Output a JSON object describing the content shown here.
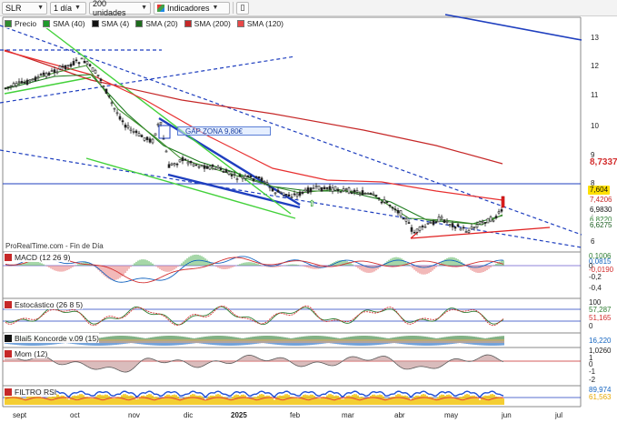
{
  "toolbar": {
    "symbol": "SLR",
    "timeframe": "1 día",
    "units": "200 unidades",
    "indicators_label": "Indicadores"
  },
  "main_legend": {
    "items": [
      {
        "label": "Precio",
        "color": "#2e8b2e"
      },
      {
        "label": "SMA (40)",
        "color": "#1e9a2a"
      },
      {
        "label": "SMA (4)",
        "color": "#111111"
      },
      {
        "label": "SMA (20)",
        "color": "#1d6b1d"
      },
      {
        "label": "SMA (200)",
        "color": "#c62828"
      },
      {
        "label": "SMA (120)",
        "color": "#e84848"
      }
    ]
  },
  "annotations": {
    "gap_label": "GAP ZONA 9,80€",
    "source": "ProRealTime.com - Fin de Día"
  },
  "price_axis": {
    "ticks": [
      "13",
      "12",
      "11",
      "10",
      "9",
      "8",
      "7",
      "6"
    ],
    "tags": [
      {
        "text": "8,7337",
        "color": "#d32f2f",
        "bg": "#ffffff"
      },
      {
        "text": "7,604",
        "color": "#111111",
        "bg": "#ffe000"
      },
      {
        "text": "7,4206",
        "color": "#c62828",
        "bg": "#ffffff"
      },
      {
        "text": "6,9830",
        "color": "#111111",
        "bg": "#ffffff"
      },
      {
        "text": "6,8220",
        "color": "#2e7d32",
        "bg": "#ffffff"
      },
      {
        "text": "6,6275",
        "color": "#1b5e20",
        "bg": "#ffffff"
      }
    ]
  },
  "macd": {
    "legend": "MACD (12 26 9)",
    "ticks": [
      "0,2",
      "0",
      "-0,2",
      "-0,4"
    ],
    "tags": [
      {
        "text": "0,1006",
        "color": "#2e7d32"
      },
      {
        "text": "0,0815",
        "color": "#1565c0"
      },
      {
        "text": "-0,0190",
        "color": "#d32f2f"
      }
    ]
  },
  "stochastic": {
    "legend": "Estocástico (26 8 5)",
    "ticks": [
      "100",
      "0"
    ],
    "tags": [
      {
        "text": "57,287",
        "color": "#2e7d32"
      },
      {
        "text": "51,165",
        "color": "#d32f2f"
      }
    ]
  },
  "koncorde": {
    "legend": "Blai5 Koncorde v.09 (15)",
    "tags": [
      {
        "text": "16,220",
        "color": "#1565c0"
      }
    ]
  },
  "momentum": {
    "legend": "Mom (12)",
    "ticks": [
      "1,0260",
      "1",
      "0",
      "-1",
      "-2"
    ]
  },
  "filtro_rsi": {
    "legend": "FILTRO RSI",
    "tags": [
      {
        "text": "89,974",
        "color": "#1565c0"
      },
      {
        "text": "61,563",
        "color": "#e6a800"
      }
    ]
  },
  "x_axis": {
    "labels": [
      {
        "text": "sept",
        "bold": false
      },
      {
        "text": "oct",
        "bold": false
      },
      {
        "text": "nov",
        "bold": false
      },
      {
        "text": "dic",
        "bold": false
      },
      {
        "text": "2025",
        "bold": true
      },
      {
        "text": "feb",
        "bold": false
      },
      {
        "text": "mar",
        "bold": false
      },
      {
        "text": "abr",
        "bold": false
      },
      {
        "text": "may",
        "bold": false
      },
      {
        "text": "jun",
        "bold": false
      },
      {
        "text": "jul",
        "bold": false
      }
    ]
  }
}
